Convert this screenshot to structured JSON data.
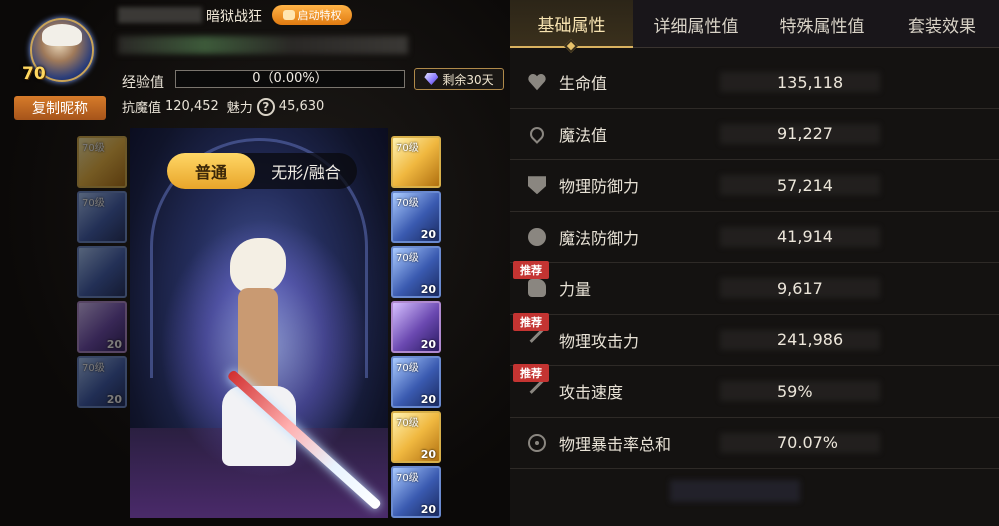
{
  "profile": {
    "title": "暗狱战狂",
    "privilege_button": "启动特权",
    "level": "70",
    "copy_nickname_button": "复制昵称",
    "exp_label": "经验值",
    "exp_value": "0（0.00%）",
    "exp_fraction": 0.0,
    "remaining_days": "剩余30天",
    "resist_label": "抗魔值",
    "resist_value": "120,452",
    "charm_label": "魅力",
    "charm_value": "45,630"
  },
  "mode_toggle": {
    "normal": "普通",
    "fusion": "无形/融合",
    "selected": "普通"
  },
  "equipment": {
    "left": [
      {
        "level": "70级",
        "enhance": "",
        "tint": "gold",
        "faded": true
      },
      {
        "level": "70级",
        "enhance": "",
        "tint": "blue",
        "faded": true
      },
      {
        "level": "",
        "enhance": "",
        "tint": "blue",
        "faded": true
      },
      {
        "level": "",
        "enhance": "20",
        "tint": "purple",
        "faded": true
      },
      {
        "level": "70级",
        "enhance": "20",
        "tint": "blue",
        "faded": true
      }
    ],
    "right": [
      {
        "level": "70级",
        "enhance": "",
        "tint": "gold",
        "faded": false
      },
      {
        "level": "70级",
        "enhance": "20",
        "tint": "blue",
        "faded": false
      },
      {
        "level": "70级",
        "enhance": "20",
        "tint": "blue",
        "faded": false
      },
      {
        "level": "",
        "enhance": "20",
        "tint": "purple",
        "faded": false
      },
      {
        "level": "70级",
        "enhance": "20",
        "tint": "blue",
        "faded": false
      },
      {
        "level": "70级",
        "enhance": "20",
        "tint": "gold",
        "faded": false
      },
      {
        "level": "70级",
        "enhance": "20",
        "tint": "blue",
        "faded": false
      }
    ]
  },
  "tabs": [
    {
      "label": "基础属性",
      "active": true
    },
    {
      "label": "详细属性值",
      "active": false
    },
    {
      "label": "特殊属性值",
      "active": false
    },
    {
      "label": "套装效果",
      "active": false
    }
  ],
  "attributes": [
    {
      "name": "生命值",
      "value": "135,118",
      "icon": "heart-icon",
      "recommended": false
    },
    {
      "name": "魔法值",
      "value": "91,227",
      "icon": "heart-outline-icon",
      "recommended": false
    },
    {
      "name": "物理防御力",
      "value": "57,214",
      "icon": "shield-icon",
      "recommended": false
    },
    {
      "name": "魔法防御力",
      "value": "41,914",
      "icon": "magic-orb-icon",
      "recommended": false
    },
    {
      "name": "力量",
      "value": "9,617",
      "icon": "fist-icon",
      "recommended": true
    },
    {
      "name": "物理攻击力",
      "value": "241,986",
      "icon": "sword-icon",
      "recommended": true
    },
    {
      "name": "攻击速度",
      "value": "59%",
      "icon": "sword-icon",
      "recommended": true
    },
    {
      "name": "物理暴击率总和",
      "value": "70.07%",
      "icon": "target-icon",
      "recommended": false
    }
  ],
  "recommended_badge": "推荐",
  "colors": {
    "accent_gold": "#d9b260",
    "badge_red": "#c43432",
    "copy_button_orange": "#d67b2a"
  }
}
